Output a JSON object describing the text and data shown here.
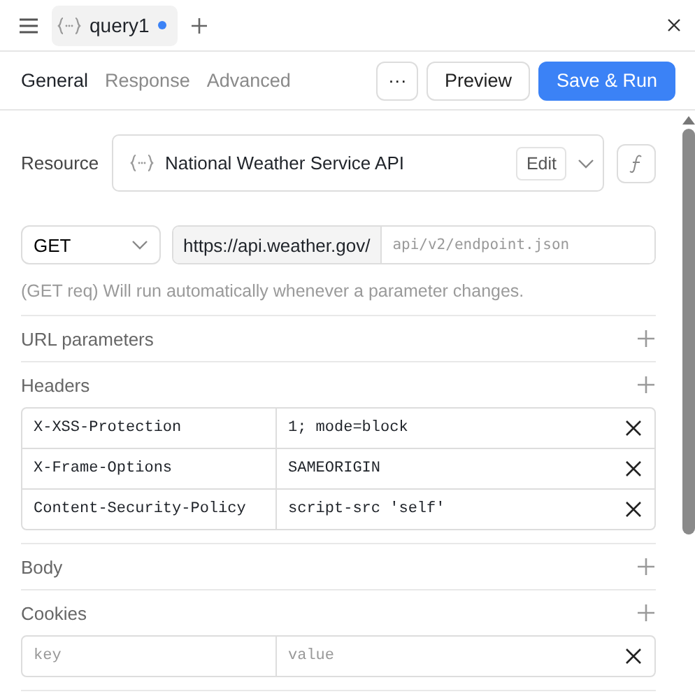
{
  "tabs": [
    {
      "label": "query1",
      "selected": true,
      "unsaved": true
    }
  ],
  "subtabs": [
    {
      "label": "General",
      "selected": true
    },
    {
      "label": "Response",
      "selected": false
    },
    {
      "label": "Advanced",
      "selected": false
    }
  ],
  "actions": {
    "more": "···",
    "preview": "Preview",
    "run": "Save & Run"
  },
  "resource": {
    "label": "Resource",
    "value": "National Weather Service API",
    "edit": "Edit"
  },
  "request": {
    "method": "GET",
    "base_url": "https://api.weather.gov/",
    "path_placeholder": "api/v2/endpoint.json"
  },
  "hint": "(GET req) Will run automatically whenever a parameter changes.",
  "sections": [
    {
      "title": "URL parameters"
    },
    {
      "title": "Headers",
      "rows": [
        {
          "kind": "entry",
          "key": "X-XSS-Protection",
          "value": "1; mode=block"
        },
        {
          "kind": "entry",
          "key": "X-Frame-Options",
          "value": "SAMEORIGIN"
        },
        {
          "kind": "entry",
          "key": "Content-Security-Policy",
          "value": "script-src 'self'"
        }
      ]
    },
    {
      "title": "Body"
    },
    {
      "title": "Cookies",
      "rows": [
        {
          "kind": "empty",
          "key_placeholder": "key",
          "value_placeholder": "value"
        }
      ]
    }
  ]
}
